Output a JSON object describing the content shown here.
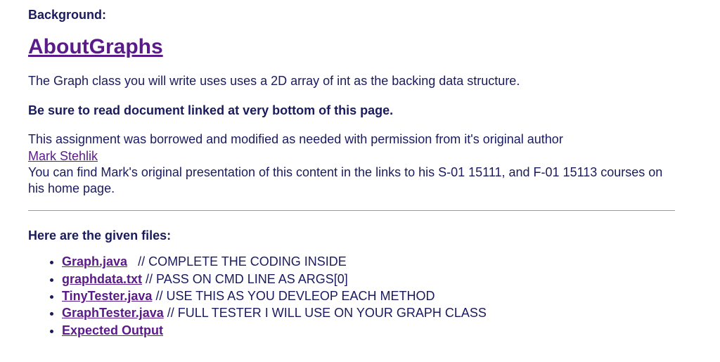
{
  "background_label": "Background:",
  "main_link": "AboutGraphs",
  "intro_para": "The Graph class you will write uses uses a 2D array of int as the backing data structure.",
  "read_note": "Be sure to read document linked at very bottom of this page.",
  "attribution": {
    "prefix": "This assignment was borrowed and modified as needed with permission from it's original author",
    "author_link": "Mark Stehlik",
    "suffix": "You can find Mark's original presentation of this content in the links to his S-01 15111, and F-01 15113 courses on his home page."
  },
  "files_heading": "Here are the given files:",
  "files": [
    {
      "name": "Graph.java",
      "spacer": "   ",
      "comment": "// COMPLETE THE CODING INSIDE"
    },
    {
      "name": "graphdata.txt",
      "spacer": " ",
      "comment": "// PASS ON CMD LINE AS ARGS[0]"
    },
    {
      "name": "TinyTester.java",
      "spacer": " ",
      "comment": "// USE THIS AS YOU DEVLEOP EACH METHOD"
    },
    {
      "name": "GraphTester.java",
      "spacer": " ",
      "comment": "// FULL TESTER I WILL USE ON YOUR GRAPH CLASS"
    },
    {
      "name": "Expected Output",
      "spacer": "",
      "comment": ""
    }
  ]
}
